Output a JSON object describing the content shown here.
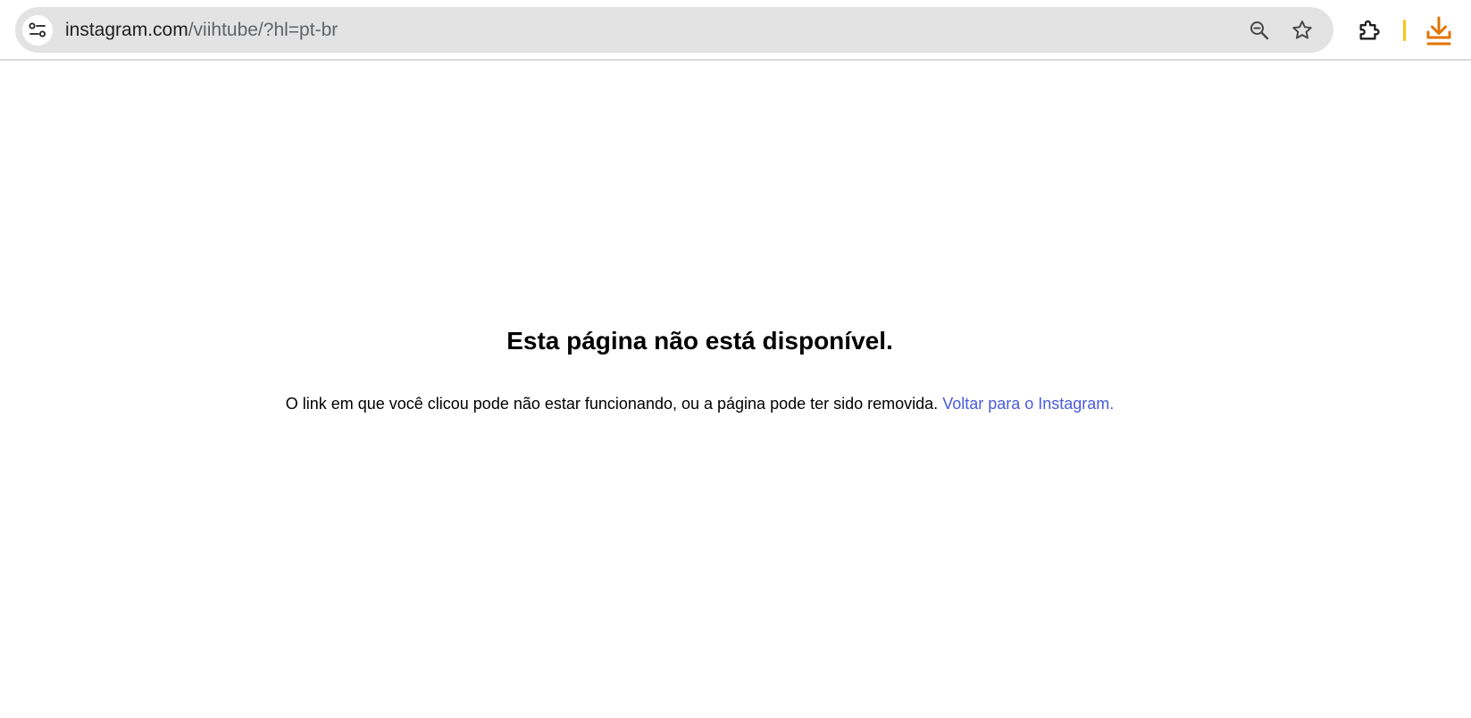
{
  "browser": {
    "url_host": "instagram.com",
    "url_path": "/viihtube/?hl=pt-br",
    "icons": {
      "site_info": "tune-icon",
      "zoom": "zoom-out-icon",
      "bookmark": "star-icon",
      "extensions": "puzzle-piece-icon",
      "downloads": "download-icon"
    },
    "colors": {
      "omnibox_bg": "#e3e3e3",
      "download_accent": "#e37400",
      "separator": "#f5c518"
    }
  },
  "page": {
    "headline": "Esta página não está disponível.",
    "message": "O link em que você clicou pode não estar funcionando, ou a página pode ter sido removida.",
    "link_label": "Voltar para o Instagram.",
    "colors": {
      "link": "#4a5bd9",
      "text": "#000000"
    }
  }
}
